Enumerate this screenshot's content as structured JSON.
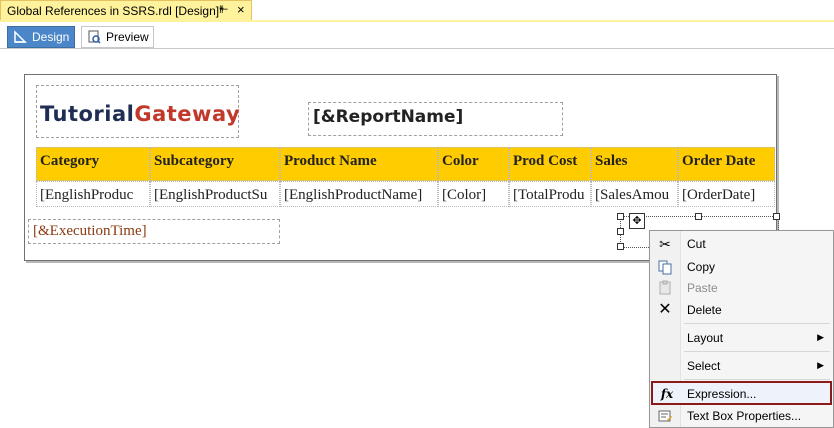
{
  "document_tab": {
    "title": "Global References in SSRS.rdl [Design]*",
    "pin_icon": "pin-icon",
    "close_icon": "close-icon"
  },
  "view_tabs": [
    {
      "label": "Design",
      "icon": "design-icon",
      "active": true
    },
    {
      "label": "Preview",
      "icon": "preview-icon",
      "active": false
    }
  ],
  "report": {
    "logo": {
      "part1": "Tutorial",
      "part2": "Gateway"
    },
    "report_name": "[&ReportName]",
    "table": {
      "headers": [
        "Category",
        "Subcategory",
        "Product Name",
        "Color",
        "Prod Cost",
        "Sales",
        "Order Date"
      ],
      "details": [
        "[EnglishProduc",
        "[EnglishProductSu",
        "[EnglishProductName]",
        "[Color]",
        "[TotalProdu",
        "[SalesAmou",
        "[OrderDate]"
      ]
    },
    "execution_time": "[&ExecutionTime]"
  },
  "context_menu": {
    "items": [
      {
        "label": "Cut",
        "icon": "scissors-icon",
        "disabled": false
      },
      {
        "label": "Copy",
        "icon": "copy-icon",
        "disabled": false
      },
      {
        "label": "Paste",
        "icon": "paste-icon",
        "disabled": true
      },
      {
        "label": "Delete",
        "icon": "delete-icon",
        "disabled": false
      },
      {
        "label": "Layout",
        "submenu": true
      },
      {
        "label": "Select",
        "submenu": true
      },
      {
        "label": "Expression...",
        "icon": "fx-icon",
        "highlighted": true
      },
      {
        "label": "Text Box Properties...",
        "icon": "properties-icon"
      }
    ]
  },
  "colors": {
    "header_bg": "#ffcc00",
    "design_tab": "#4a86c8",
    "doc_tab": "#fff29d",
    "highlight_border": "#8b1a1a"
  }
}
